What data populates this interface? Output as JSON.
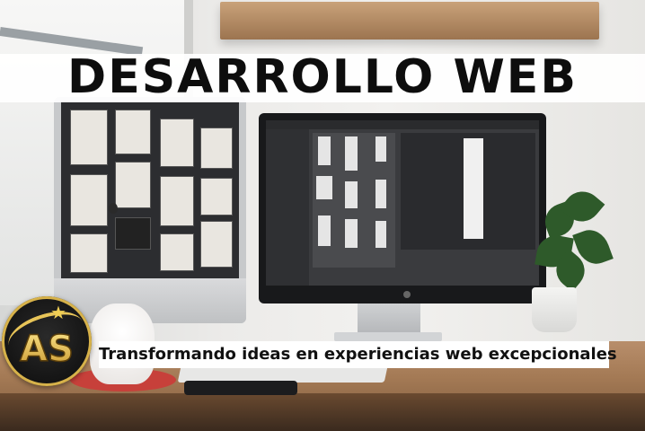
{
  "headline": "DESARROLLO WEB",
  "tagline": "Transformando ideas en experiencias web excepcionales",
  "logo": {
    "monogram": "AS",
    "icon": "star-icon"
  },
  "colors": {
    "logo_gold": "#e7c458",
    "logo_dark": "#111111",
    "headline": "#0d0d0d"
  }
}
